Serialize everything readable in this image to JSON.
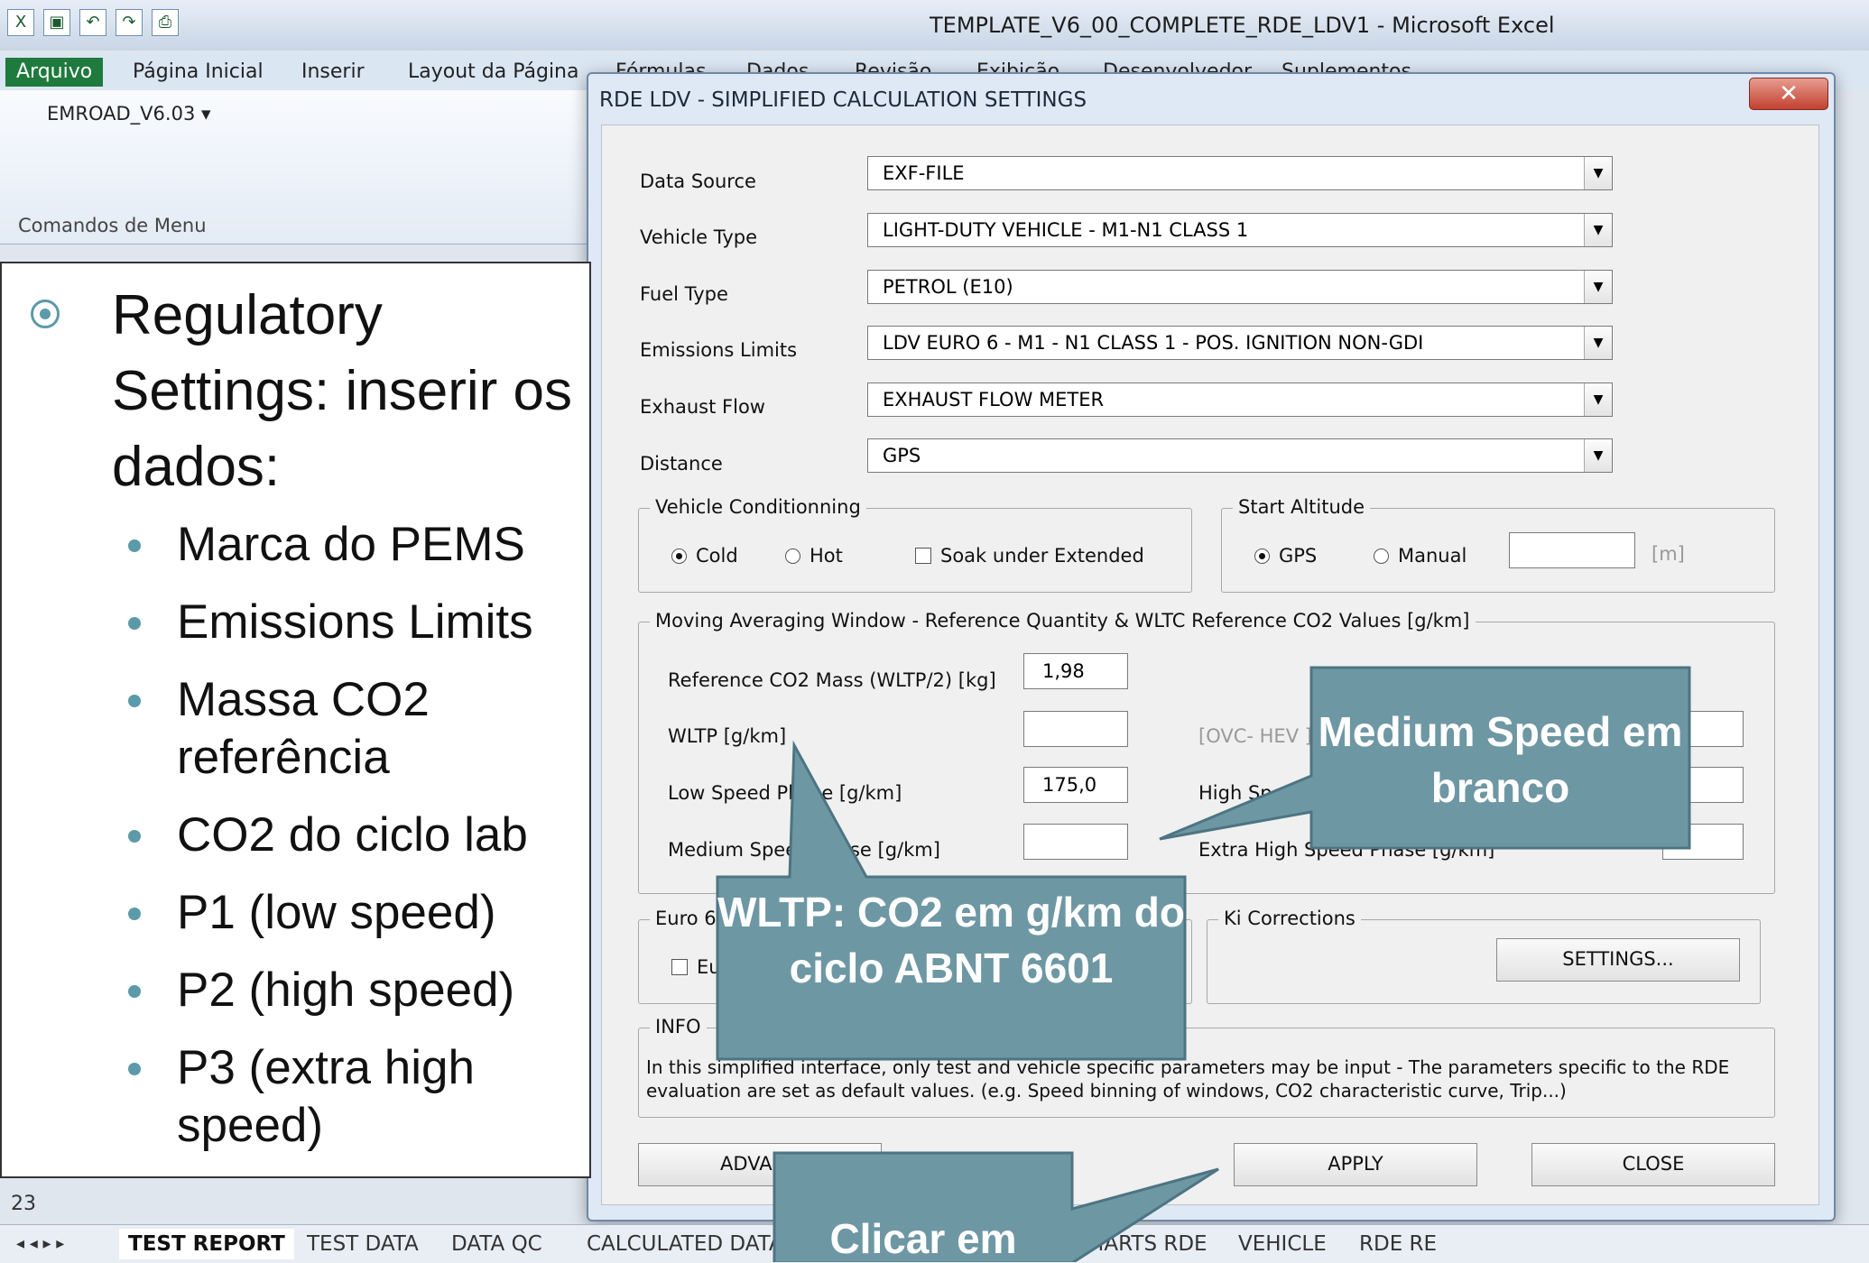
{
  "window": {
    "title": "TEMPLATE_V6_00_COMPLETE_RDE_LDV1  -  Microsoft Excel"
  },
  "ribbon": {
    "tabs": [
      "Arquivo",
      "Página Inicial",
      "Inserir",
      "Layout da Página",
      "Fórmulas",
      "Dados",
      "Revisão",
      "Exibição",
      "Desenvolvedor",
      "Suplementos"
    ],
    "menu_button": "EMROAD_V6.03 ▾",
    "group_label": "Comandos de Menu"
  },
  "dialog": {
    "title": "RDE LDV - SIMPLIFIED CALCULATION SETTINGS",
    "close_glyph": "✕",
    "fields": [
      {
        "label": "Data Source",
        "value": "EXF-FILE"
      },
      {
        "label": "Vehicle Type",
        "value": "LIGHT-DUTY VEHICLE - M1-N1 CLASS 1"
      },
      {
        "label": "Fuel Type",
        "value": "PETROL (E10)"
      },
      {
        "label": "Emissions Limits",
        "value": "LDV EURO 6 - M1 - N1 CLASS 1 - POS. IGNITION NON-GDI"
      },
      {
        "label": "Exhaust Flow",
        "value": "EXHAUST FLOW METER"
      },
      {
        "label": "Distance",
        "value": "GPS"
      }
    ],
    "vehicle_conditioning": {
      "legend": "Vehicle Conditionning",
      "cold": "Cold",
      "hot": "Hot",
      "soak": "Soak under Extended"
    },
    "start_altitude": {
      "legend": "Start Altitude",
      "gps": "GPS",
      "manual": "Manual",
      "unit": "[m]"
    },
    "maw": {
      "legend": "Moving Averaging Window - Reference Quantity & WLTC Reference CO2 Values [g/km]",
      "ref_mass_label": "Reference CO2 Mass (WLTP/2) [kg]",
      "ref_mass_value": "1,98",
      "wltp_label": "WLTP [g/km]",
      "low_label": "Low Speed Phase [g/km]",
      "low_value": "175,0",
      "medium_label": "Medium Speed Phase [g/km]",
      "ovc_label": "[OVC- HEV ] V",
      "high_label": "High Speed Phase [g/km]",
      "extra_label": "Extra High Speed Phase [g/km]"
    },
    "euro6": {
      "legend": "Euro 6",
      "check": "Eu"
    },
    "ki": {
      "legend": "Ki Corrections",
      "button": "SETTINGS..."
    },
    "info": {
      "legend": "INFO",
      "text": "In this simplified interface, only test and vehicle specific parameters may be input - The parameters specific to the RDE evaluation are set as default values. (e.g. Speed binning of windows, CO2 characteristic curve, Trip...)"
    },
    "buttons": {
      "advanced": "ADVANC",
      "apply": "APPLY",
      "close": "CLOSE"
    }
  },
  "sheet": {
    "row_number": "23",
    "tabs": [
      "TEST REPORT",
      "TEST DATA",
      "DATA QC",
      "CALCULATED DATA",
      "CHARTS RDE",
      "VEHICLE",
      "RDE RE"
    ]
  },
  "slide": {
    "heading": "Regulatory Settings: inserir os dados:",
    "bullets": [
      "Marca do PEMS",
      "Emissions Limits",
      "Massa CO2 referência",
      "CO2 do ciclo lab",
      "P1 (low speed)",
      "P2 (high speed)",
      "P3 (extra high speed)"
    ]
  },
  "callouts": {
    "medium": "Medium Speed em branco",
    "wltp": "WLTP: CO2 em g/km do ciclo ABNT 6601",
    "click": "Clicar em"
  },
  "colors": {
    "callout_fill": "#6e97a4",
    "callout_border": "#4d7482",
    "bullet": "#5b9aa9",
    "excel_green": "#1f7a3d"
  }
}
